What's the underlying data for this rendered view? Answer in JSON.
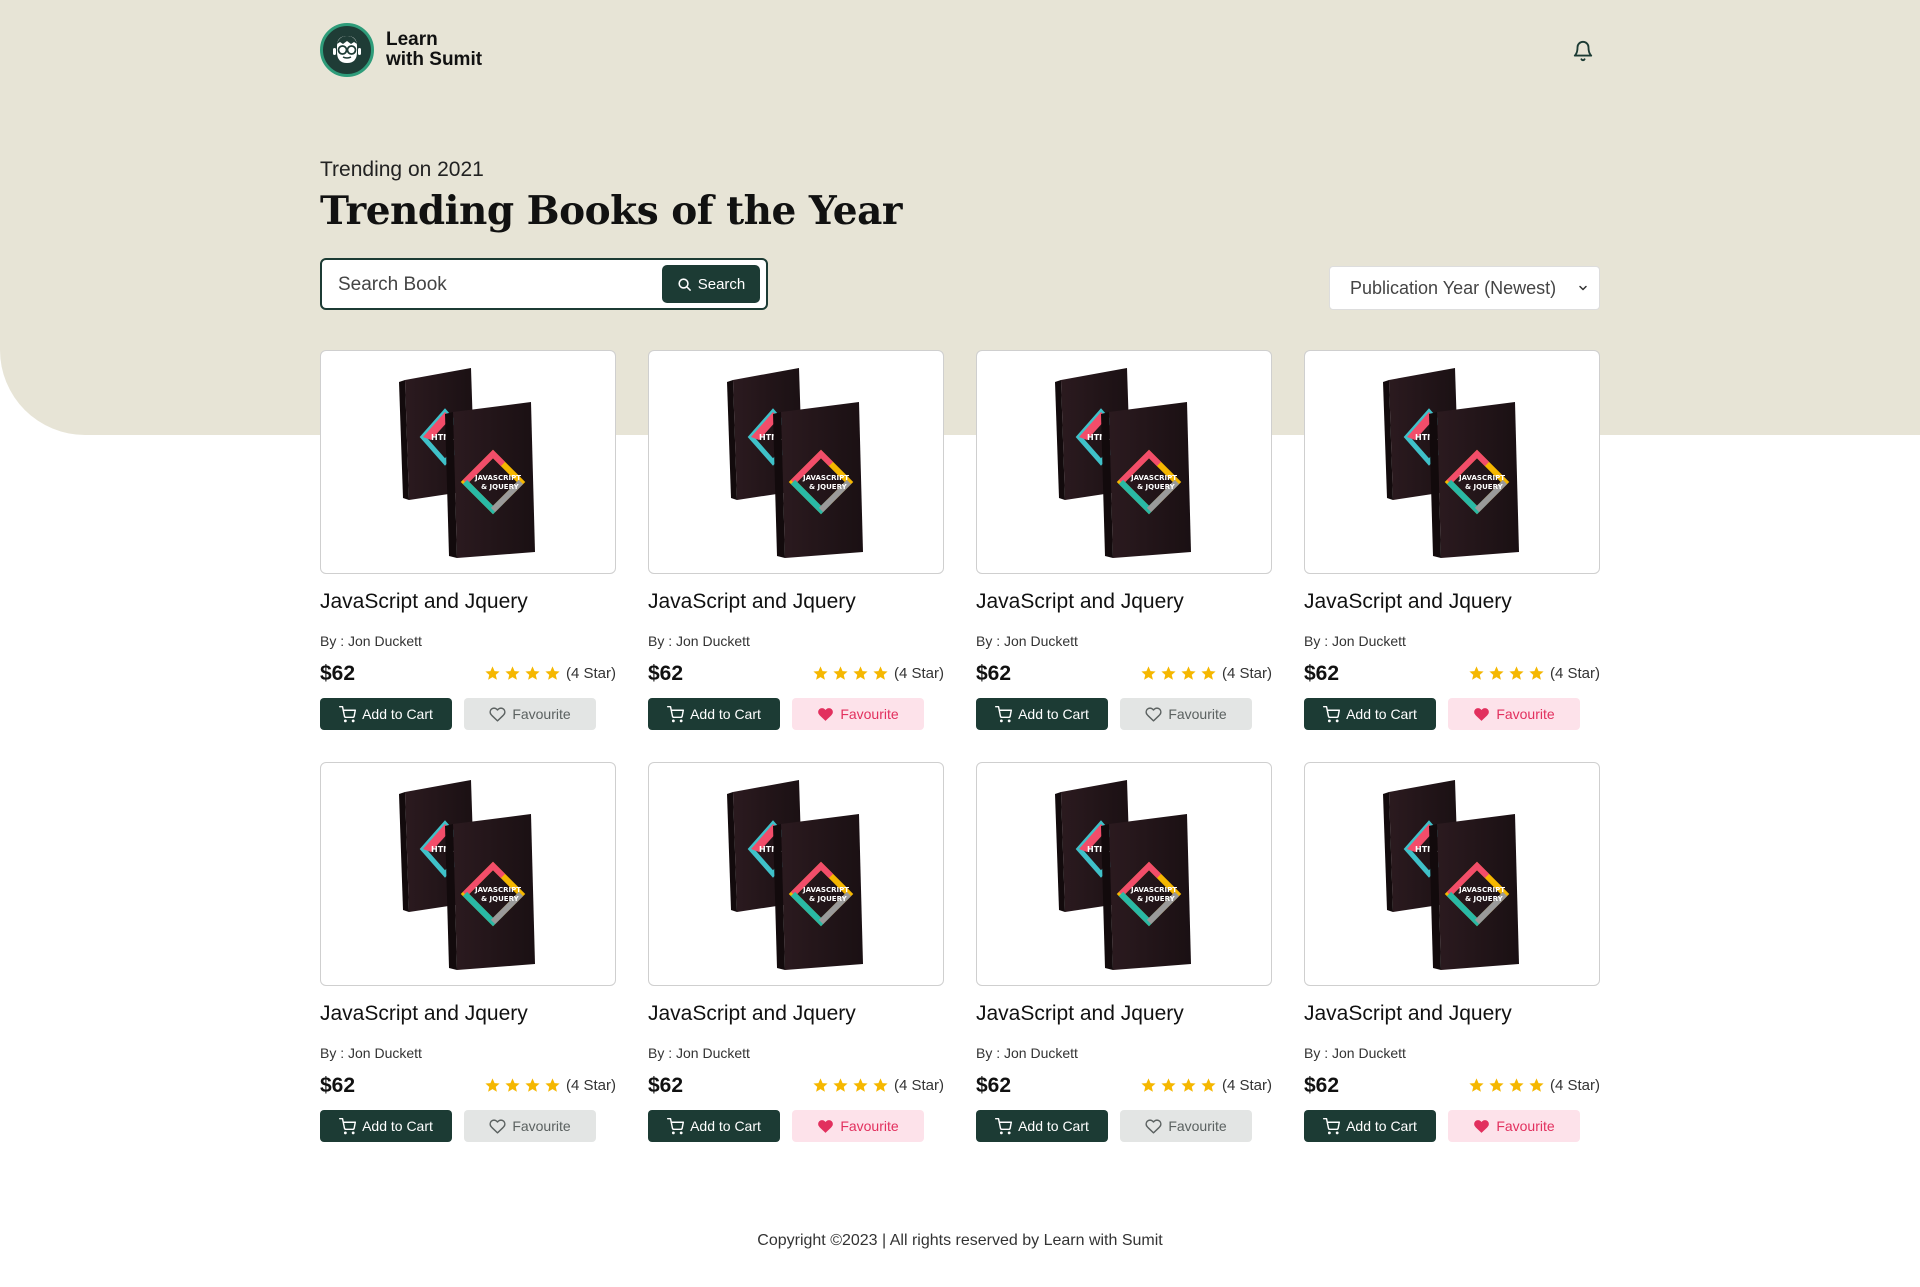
{
  "colors": {
    "hero_bg": "#e7e4d6",
    "primary": "#1c3b34",
    "favourite_active": "#e2305e",
    "favourite_active_bg": "#fde2ea",
    "favourite_inactive_bg": "#e3e5e4",
    "star": "#f5b700"
  },
  "brand": {
    "line1": "Learn",
    "line2": "with Sumit",
    "icon": "nerd-glasses-logo-icon"
  },
  "header": {
    "notification_icon": "bell-icon"
  },
  "hero": {
    "subtitle": "Trending on 2021",
    "title": "Trending Books of the Year"
  },
  "search": {
    "placeholder": "Search Book",
    "value": "",
    "button_label": "Search",
    "icon": "search-icon"
  },
  "sort": {
    "selected": "Publication Year (Newest)",
    "icon": "chevron-down-icon"
  },
  "books": [
    {
      "title": "JavaScript and Jquery",
      "author": "By : Jon Duckett",
      "price": "$62",
      "rating": 4,
      "rating_label": "(4 Star)",
      "cart_label": "Add to Cart",
      "fav_label": "Favourite",
      "favourited": false
    },
    {
      "title": "JavaScript and Jquery",
      "author": "By : Jon Duckett",
      "price": "$62",
      "rating": 4,
      "rating_label": "(4 Star)",
      "cart_label": "Add to Cart",
      "fav_label": "Favourite",
      "favourited": true
    },
    {
      "title": "JavaScript and Jquery",
      "author": "By : Jon Duckett",
      "price": "$62",
      "rating": 4,
      "rating_label": "(4 Star)",
      "cart_label": "Add to Cart",
      "fav_label": "Favourite",
      "favourited": false
    },
    {
      "title": "JavaScript and Jquery",
      "author": "By : Jon Duckett",
      "price": "$62",
      "rating": 4,
      "rating_label": "(4 Star)",
      "cart_label": "Add to Cart",
      "fav_label": "Favourite",
      "favourited": true
    },
    {
      "title": "JavaScript and Jquery",
      "author": "By : Jon Duckett",
      "price": "$62",
      "rating": 4,
      "rating_label": "(4 Star)",
      "cart_label": "Add to Cart",
      "fav_label": "Favourite",
      "favourited": false
    },
    {
      "title": "JavaScript and Jquery",
      "author": "By : Jon Duckett",
      "price": "$62",
      "rating": 4,
      "rating_label": "(4 Star)",
      "cart_label": "Add to Cart",
      "fav_label": "Favourite",
      "favourited": true
    },
    {
      "title": "JavaScript and Jquery",
      "author": "By : Jon Duckett",
      "price": "$62",
      "rating": 4,
      "rating_label": "(4 Star)",
      "cart_label": "Add to Cart",
      "fav_label": "Favourite",
      "favourited": false
    },
    {
      "title": "JavaScript and Jquery",
      "author": "By : Jon Duckett",
      "price": "$62",
      "rating": 4,
      "rating_label": "(4 Star)",
      "cart_label": "Add to Cart",
      "fav_label": "Favourite",
      "favourited": true
    }
  ],
  "footer": {
    "text": "Copyright ©2023 | All rights reserved by Learn with Sumit"
  }
}
